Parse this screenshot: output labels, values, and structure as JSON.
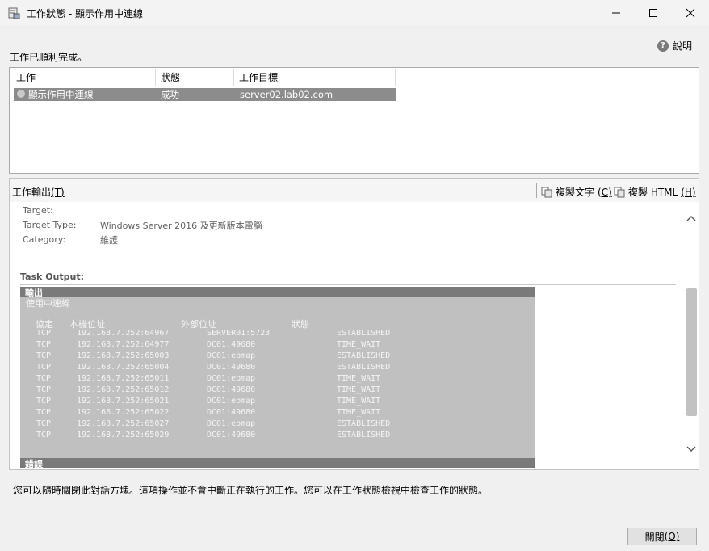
{
  "window": {
    "title": "工作狀態 - 顯示作用中連線",
    "minimize_glyph": "—",
    "maximize_glyph": "☐",
    "close_glyph": "✕"
  },
  "help": {
    "label": "說明",
    "icon": "help-icon"
  },
  "status_message": "工作已順利完成。",
  "task_grid": {
    "columns": [
      "工作",
      "狀態",
      "工作目標"
    ],
    "rows": [
      {
        "task": "顯示作用中連線",
        "status": "成功",
        "target": "server02.lab02.com"
      }
    ]
  },
  "output": {
    "label": "工作輸出",
    "label_key": "(T)",
    "copy_text": "複製文字",
    "copy_text_key": "(C)",
    "copy_html": "複製 HTML",
    "copy_html_key": "(H)",
    "meta": [
      {
        "key": "Target:",
        "value": ""
      },
      {
        "key": "Target Type:",
        "value": "Windows Server 2016 及更新版本電腦"
      },
      {
        "key": "Category:",
        "value": "維護"
      }
    ],
    "task_output_label": "Task Output:",
    "console": {
      "top_bar": "輸出",
      "subtitle": "使用中連線",
      "headers": [
        "協定",
        "本機位址",
        "外部位址",
        "狀態"
      ],
      "rows": [
        {
          "proto": "TCP",
          "local": "192.168.7.252:64967",
          "remote": "SERVER01:5723",
          "state": "ESTABLISHED"
        },
        {
          "proto": "TCP",
          "local": "192.168.7.252:64977",
          "remote": "DC01:49680",
          "state": "TIME_WAIT"
        },
        {
          "proto": "TCP",
          "local": "192.168.7.252:65003",
          "remote": "DC01:epmap",
          "state": "ESTABLISHED"
        },
        {
          "proto": "TCP",
          "local": "192.168.7.252:65004",
          "remote": "DC01:49680",
          "state": "ESTABLISHED"
        },
        {
          "proto": "TCP",
          "local": "192.168.7.252:65011",
          "remote": "DC01:epmap",
          "state": "TIME_WAIT"
        },
        {
          "proto": "TCP",
          "local": "192.168.7.252:65012",
          "remote": "DC01:49680",
          "state": "TIME_WAIT"
        },
        {
          "proto": "TCP",
          "local": "192.168.7.252:65021",
          "remote": "DC01:epmap",
          "state": "TIME_WAIT"
        },
        {
          "proto": "TCP",
          "local": "192.168.7.252:65022",
          "remote": "DC01:49680",
          "state": "TIME_WAIT"
        },
        {
          "proto": "TCP",
          "local": "192.168.7.252:65027",
          "remote": "DC01:epmap",
          "state": "ESTABLISHED"
        },
        {
          "proto": "TCP",
          "local": "192.168.7.252:65029",
          "remote": "DC01:49680",
          "state": "ESTABLISHED"
        }
      ],
      "bottom_bar": "錯誤"
    }
  },
  "footer_note": "您可以隨時關閉此對話方塊。這項操作並不會中斷正在執行的工作。您可以在工作狀態檢視中檢查工作的狀態。",
  "close_button": {
    "label": "關閉",
    "key": "(O)"
  }
}
